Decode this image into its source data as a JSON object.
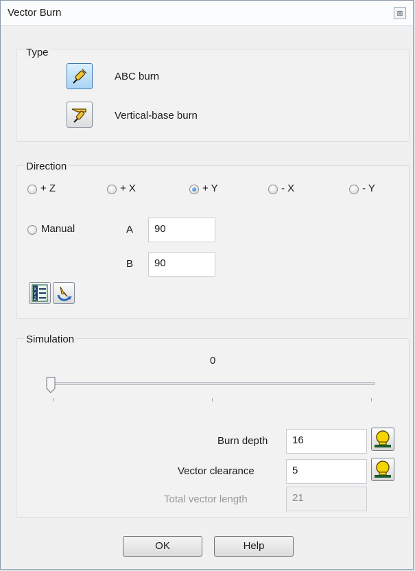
{
  "window": {
    "title": "Vector Burn",
    "close_glyph": "⊠"
  },
  "type_group": {
    "label": "Type",
    "options": [
      {
        "label": "ABC burn",
        "icon": "abc-burn-icon",
        "selected": true
      },
      {
        "label": "Vertical-base burn",
        "icon": "vertical-base-burn-icon",
        "selected": false
      }
    ]
  },
  "direction_group": {
    "label": "Direction",
    "radios": [
      {
        "label": "+ Z",
        "checked": false
      },
      {
        "label": "+ X",
        "checked": false
      },
      {
        "label": "+ Y",
        "checked": true
      },
      {
        "label": "- X",
        "checked": false
      },
      {
        "label": "- Y",
        "checked": false
      }
    ],
    "manual": {
      "label": "Manual",
      "checked": false
    },
    "a_label": "A",
    "a_value": "90",
    "b_label": "B",
    "b_value": "90",
    "tools": [
      "xyz-list-icon",
      "direction-pick-icon"
    ]
  },
  "simulation_group": {
    "label": "Simulation",
    "slider_value": "0",
    "slider_fraction": 0,
    "burn_depth_label": "Burn depth",
    "burn_depth_value": "16",
    "vector_clearance_label": "Vector clearance",
    "vector_clearance_value": "5",
    "total_length_label": "Total vector length",
    "total_length_value": "21"
  },
  "buttons": {
    "ok": "OK",
    "help": "Help"
  },
  "colors": {
    "selected_button": "#a9d4f5",
    "radio_dot": "#1a5fa6",
    "bulb_yellow": "#f5d400"
  }
}
